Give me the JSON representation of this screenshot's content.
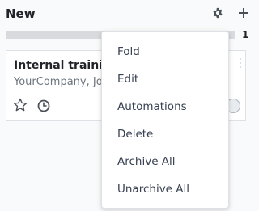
{
  "column": {
    "title": "New",
    "record_count": "1",
    "progress_fraction": 0.0,
    "icons": {
      "settings": "gear-icon",
      "quick_create": "plus-icon"
    }
  },
  "card": {
    "title": "Internal training",
    "subtitle": "YourCompany, Jo",
    "icons": {
      "priority": "star-icon",
      "activity": "clock-icon",
      "menu": "kebab-icon",
      "status": "status-circle"
    }
  },
  "menu": {
    "items": [
      {
        "label": "Fold"
      },
      {
        "label": "Edit"
      },
      {
        "label": "Automations"
      },
      {
        "label": "Delete"
      },
      {
        "label": "Archive All"
      },
      {
        "label": "Unarchive All"
      }
    ]
  },
  "colors": {
    "text": "#212529",
    "muted": "#6c757d",
    "icon": "#495057",
    "progress_track": "#d8dadd",
    "menu_text": "#374151"
  }
}
